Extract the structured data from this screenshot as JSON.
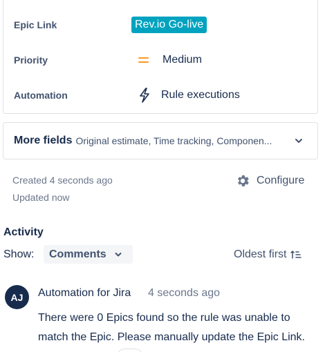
{
  "fields": {
    "epic_link": {
      "label": "Epic Link",
      "value": "Rev.io Go-live",
      "color": "#00a3bf"
    },
    "priority": {
      "label": "Priority",
      "value": "Medium",
      "icon": "priority-medium-icon",
      "color": "#ff991f"
    },
    "automation": {
      "label": "Automation",
      "value": "Rule executions",
      "icon": "lightning-bolt-icon"
    }
  },
  "more_fields": {
    "title": "More fields",
    "summary": "Original estimate, Time tracking, Componen...",
    "icon": "chevron-down-icon"
  },
  "meta": {
    "created": "Created 4 seconds ago",
    "updated": "Updated now",
    "configure_label": "Configure",
    "configure_icon": "gear-icon"
  },
  "activity": {
    "title": "Activity",
    "show_label": "Show:",
    "show_value": "Comments",
    "sort_label": "Oldest first",
    "sort_icon": "sort-ascending-icon"
  },
  "comment": {
    "avatar_initials": "AJ",
    "author": "Automation for Jira",
    "time": "4 seconds ago",
    "body": "There were 0 Epics found so the rule was unable to match the Epic.  Please manually update the Epic Link."
  }
}
